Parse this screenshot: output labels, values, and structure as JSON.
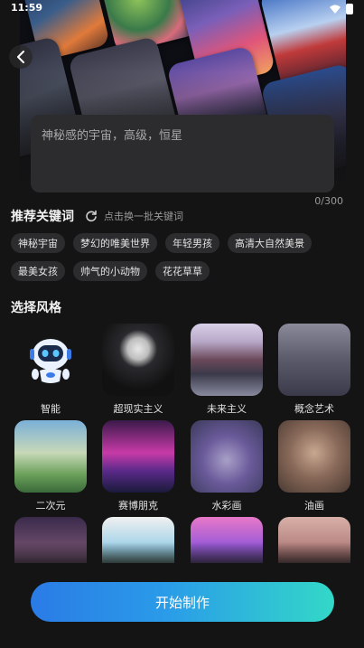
{
  "status_bar": {
    "time": "11:59"
  },
  "prompt": {
    "text": "神秘感的宇宙，高级，恒星",
    "counter": "0/300"
  },
  "keywords": {
    "title": "推荐关键词",
    "refresh_label": "点击换一批关键词",
    "items": [
      "神秘宇宙",
      "梦幻的唯美世界",
      "年轻男孩",
      "高清大自然美景",
      "最美女孩",
      "帅气的小动物",
      "花花草草"
    ]
  },
  "styles": {
    "title": "选择风格",
    "items": [
      {
        "label": "智能"
      },
      {
        "label": "超现实主义"
      },
      {
        "label": "未来主义"
      },
      {
        "label": "概念艺术"
      },
      {
        "label": "二次元"
      },
      {
        "label": "赛博朋克"
      },
      {
        "label": "水彩画"
      },
      {
        "label": "油画"
      }
    ]
  },
  "start_button": {
    "label": "开始制作"
  },
  "colors": {
    "background": "#141414",
    "chip": "#2c2c2e",
    "button_start": "#2a7be6",
    "button_end": "#33d8c8"
  },
  "icons": [
    "back-arrow-icon",
    "wifi-icon",
    "battery-icon",
    "refresh-icon",
    "robot-icon"
  ]
}
